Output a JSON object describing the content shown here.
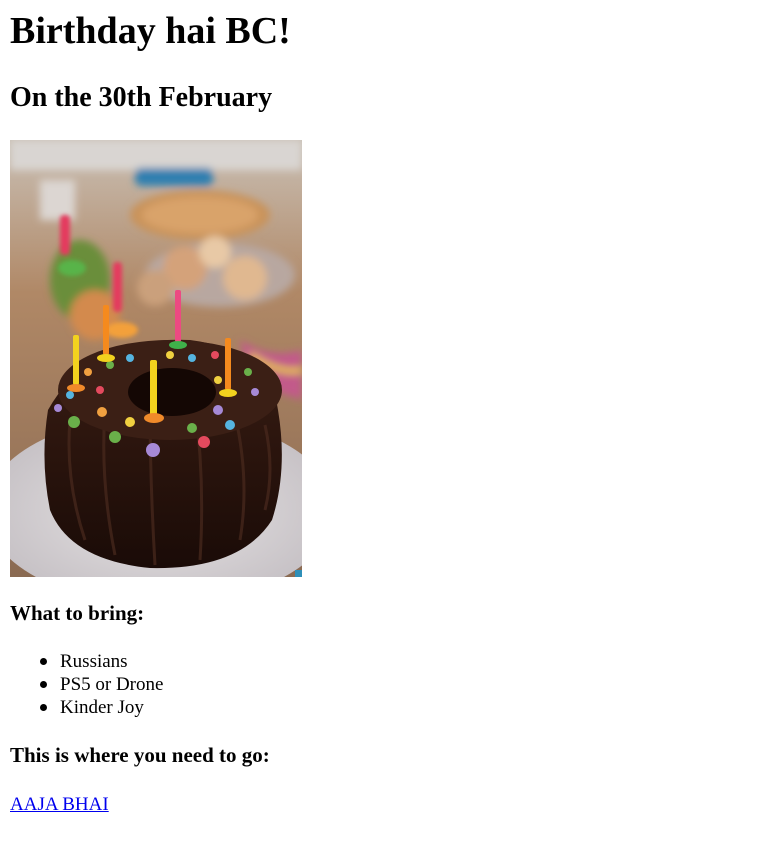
{
  "title": "Birthday hai BC!",
  "date_heading": "On the 30th February",
  "bring": {
    "heading": "What to bring:",
    "items": [
      "Russians",
      "PS5 or Drone",
      "Kinder Joy"
    ]
  },
  "directions": {
    "heading": "This is where you need to go:",
    "link_text": "AAJA BHAI"
  },
  "colors": {
    "link": "#0000ee",
    "text": "#000000",
    "background": "#ffffff"
  }
}
